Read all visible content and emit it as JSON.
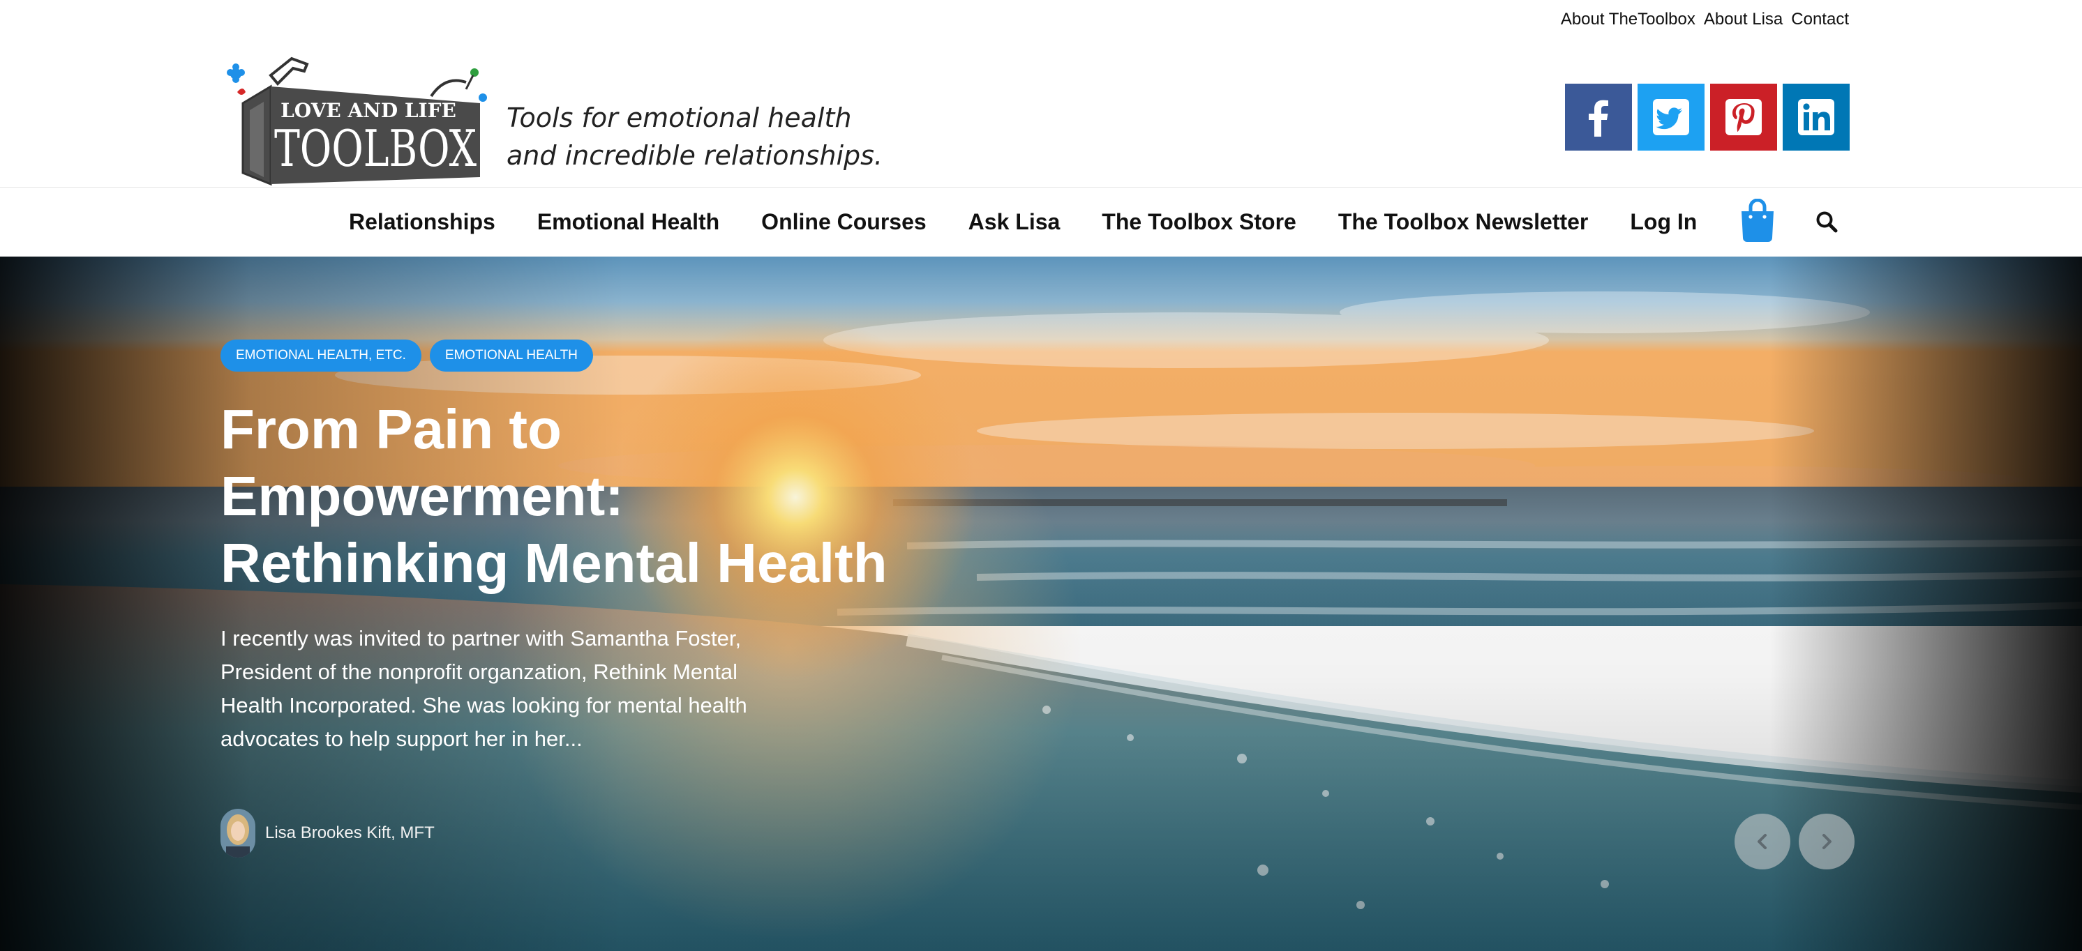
{
  "top_links": [
    "About TheToolbox",
    "About Lisa",
    "Contact"
  ],
  "logo": {
    "line1": "LOVE AND LIFE",
    "line2": "TOOLBOX"
  },
  "tagline": {
    "line1": "Tools for emotional health",
    "line2": "and incredible relationships."
  },
  "social": [
    {
      "name": "facebook-icon",
      "color": "#3b5998"
    },
    {
      "name": "twitter-icon",
      "color": "#1da1f2"
    },
    {
      "name": "pinterest-icon",
      "color": "#cb2027"
    },
    {
      "name": "linkedin-icon",
      "color": "#0077b5"
    }
  ],
  "nav": [
    "Relationships",
    "Emotional Health",
    "Online Courses",
    "Ask Lisa",
    "The Toolbox Store",
    "The Toolbox Newsletter",
    "Log In"
  ],
  "hero": {
    "tags": [
      "EMOTIONAL HEALTH, ETC.",
      "EMOTIONAL HEALTH"
    ],
    "title": "From Pain to Empowerment: Rethinking Mental Health",
    "excerpt": "I recently was invited to partner with Samantha Foster, President of the nonprofit organzation, Rethink Mental Health Incorporated.  She was looking for mental health advocates to help support her in her...",
    "author": "Lisa Brookes Kift, MFT"
  },
  "colors": {
    "accent": "#1e90e8"
  }
}
